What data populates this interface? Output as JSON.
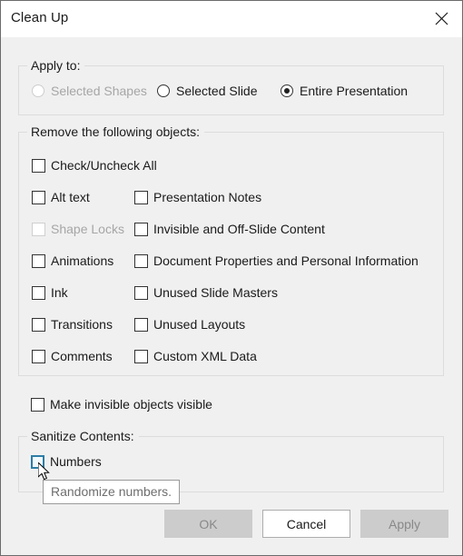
{
  "window": {
    "title": "Clean Up",
    "close_icon": "close-icon"
  },
  "apply_to": {
    "legend": "Apply to:",
    "options": [
      {
        "label": "Selected Shapes",
        "selected": false,
        "disabled": true
      },
      {
        "label": "Selected Slide",
        "selected": false,
        "disabled": false
      },
      {
        "label": "Entire Presentation",
        "selected": true,
        "disabled": false
      }
    ]
  },
  "remove_objects": {
    "legend": "Remove the following objects:",
    "select_all": {
      "label": "Check/Uncheck All",
      "checked": false,
      "disabled": false
    },
    "column_left": [
      {
        "label": "Alt text",
        "checked": false,
        "disabled": false
      },
      {
        "label": "Shape Locks",
        "checked": false,
        "disabled": true
      },
      {
        "label": "Animations",
        "checked": false,
        "disabled": false
      },
      {
        "label": "Ink",
        "checked": false,
        "disabled": false
      },
      {
        "label": "Transitions",
        "checked": false,
        "disabled": false
      },
      {
        "label": "Comments",
        "checked": false,
        "disabled": false
      }
    ],
    "column_right": [
      {
        "label": "Presentation Notes",
        "checked": false,
        "disabled": false
      },
      {
        "label": "Invisible and Off-Slide Content",
        "checked": false,
        "disabled": false
      },
      {
        "label": "Document Properties and Personal Information",
        "checked": false,
        "disabled": false
      },
      {
        "label": "Unused Slide Masters",
        "checked": false,
        "disabled": false
      },
      {
        "label": "Unused Layouts",
        "checked": false,
        "disabled": false
      },
      {
        "label": "Custom XML Data",
        "checked": false,
        "disabled": false
      }
    ]
  },
  "make_visible": {
    "label": "Make invisible objects visible",
    "checked": false,
    "disabled": false
  },
  "sanitize": {
    "legend": "Sanitize Contents:",
    "items": [
      {
        "label": "Numbers",
        "checked": false,
        "disabled": false,
        "hovered": true
      }
    ]
  },
  "tooltip": {
    "text": "Randomize numbers."
  },
  "footer": {
    "ok_label": "OK",
    "cancel_label": "Cancel",
    "apply_label": "Apply"
  },
  "colors": {
    "dialog_bg": "#f0f0f0",
    "titlebar_bg": "#ffffff",
    "group_border": "#dcdcdc",
    "text": "#1a1a1a",
    "disabled_text": "#a6a6a6",
    "hover_accent": "#2d7da6",
    "button_disabled_bg": "#cccccc"
  }
}
